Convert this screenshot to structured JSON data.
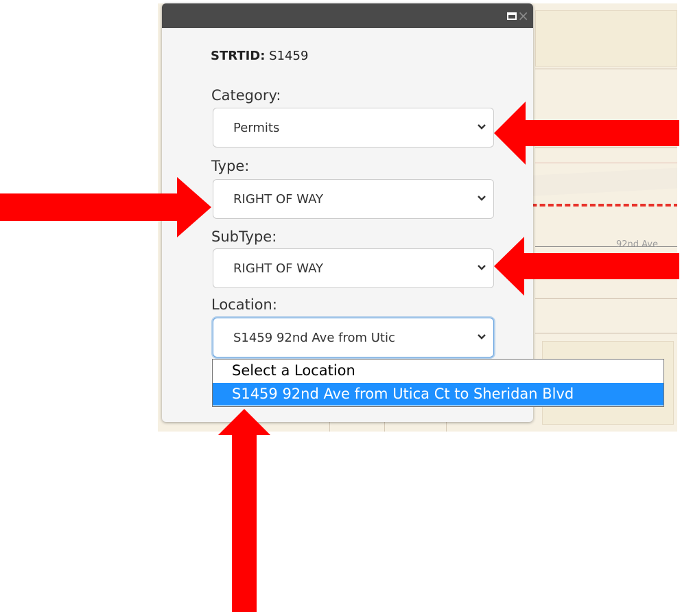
{
  "map": {
    "street_label": "92nd Ave"
  },
  "popup": {
    "strtid_label": "STRTID:",
    "strtid_value": "S1459",
    "category_label": "Category:",
    "category_value": "Permits",
    "type_label": "Type:",
    "type_value": "RIGHT OF WAY",
    "subtype_label": "SubType:",
    "subtype_value": "RIGHT OF WAY",
    "location_label": "Location:",
    "location_value": "S1459 92nd Ave from Utic"
  },
  "location_dropdown": {
    "options": [
      {
        "label": "Select a Location",
        "selected": false
      },
      {
        "label": "S1459 92nd Ave from Utica Ct to Sheridan Blvd",
        "selected": true
      }
    ]
  },
  "colors": {
    "annotation_arrow": "#ff0000",
    "selected_option": "#1e90ff",
    "titlebar": "#4a4a4a"
  }
}
